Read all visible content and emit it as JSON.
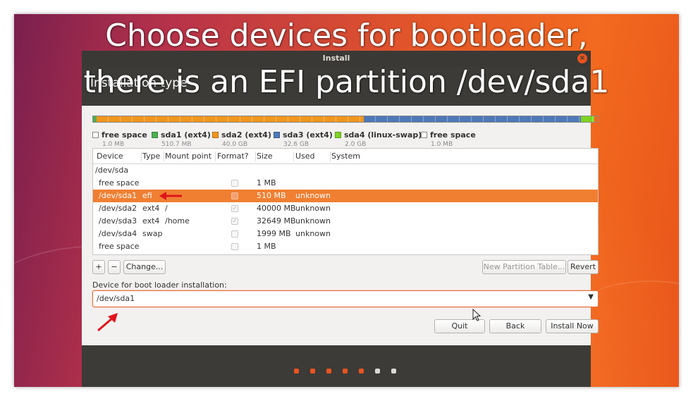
{
  "overlay": {
    "line1": "Choose devices for bootloader,",
    "line2": "there is an EFI partition /dev/sda1"
  },
  "window": {
    "title": "Install",
    "page_title": "Installation type"
  },
  "bar_segments": [
    {
      "name": "sda1",
      "color": "#4caf50",
      "fraction": 0.007
    },
    {
      "name": "sda2",
      "color": "#f0961e",
      "fraction": 0.529
    },
    {
      "name": "sda3",
      "color": "#4f79b8",
      "fraction": 0.431
    },
    {
      "name": "sda4",
      "color": "#7ed321",
      "fraction": 0.026
    }
  ],
  "legend": [
    {
      "name": "free space",
      "size": "1.0 MB",
      "color": "#ffffff"
    },
    {
      "name": "sda1 (ext4)",
      "size": "510.7 MB",
      "color": "#4caf50"
    },
    {
      "name": "sda2 (ext4)",
      "size": "40.0 GB",
      "color": "#f0961e"
    },
    {
      "name": "sda3 (ext4)",
      "size": "32.6 GB",
      "color": "#4f79b8"
    },
    {
      "name": "sda4 (linux-swap)",
      "size": "2.0 GB",
      "color": "#7ed321"
    },
    {
      "name": "free space",
      "size": "1.0 MB",
      "color": "#ffffff"
    }
  ],
  "table": {
    "headers": [
      "Device",
      "Type",
      "Mount point",
      "Format?",
      "Size",
      "Used",
      "System"
    ],
    "rows": [
      {
        "device": "/dev/sda",
        "type": "",
        "mount": "",
        "format": null,
        "size": "",
        "used": ""
      },
      {
        "device": "free space",
        "type": "",
        "mount": "",
        "format": false,
        "size": "1 MB",
        "used": ""
      },
      {
        "device": "/dev/sda1",
        "type": "efi",
        "mount": "",
        "format": false,
        "size": "510 MB",
        "used": "unknown",
        "selected": true
      },
      {
        "device": "/dev/sda2",
        "type": "ext4",
        "mount": "/",
        "format": true,
        "size": "40000 MB",
        "used": "unknown"
      },
      {
        "device": "/dev/sda3",
        "type": "ext4",
        "mount": "/home",
        "format": true,
        "size": "32649 MB",
        "used": "unknown"
      },
      {
        "device": "/dev/sda4",
        "type": "swap",
        "mount": "",
        "format": false,
        "size": "1999 MB",
        "used": "unknown"
      },
      {
        "device": "free space",
        "type": "",
        "mount": "",
        "format": false,
        "size": "1 MB",
        "used": ""
      }
    ]
  },
  "buttons": {
    "add": "+",
    "remove": "−",
    "change": "Change...",
    "new_table": "New Partition Table...",
    "revert": "Revert",
    "quit": "Quit",
    "back": "Back",
    "install": "Install Now"
  },
  "boot_loader": {
    "label": "Device for boot loader installation:",
    "value": "/dev/sda1"
  },
  "progress_dots": {
    "total": 7,
    "completed": 5,
    "active_color": "#e95420",
    "inactive_color": "#d8d8d8"
  }
}
